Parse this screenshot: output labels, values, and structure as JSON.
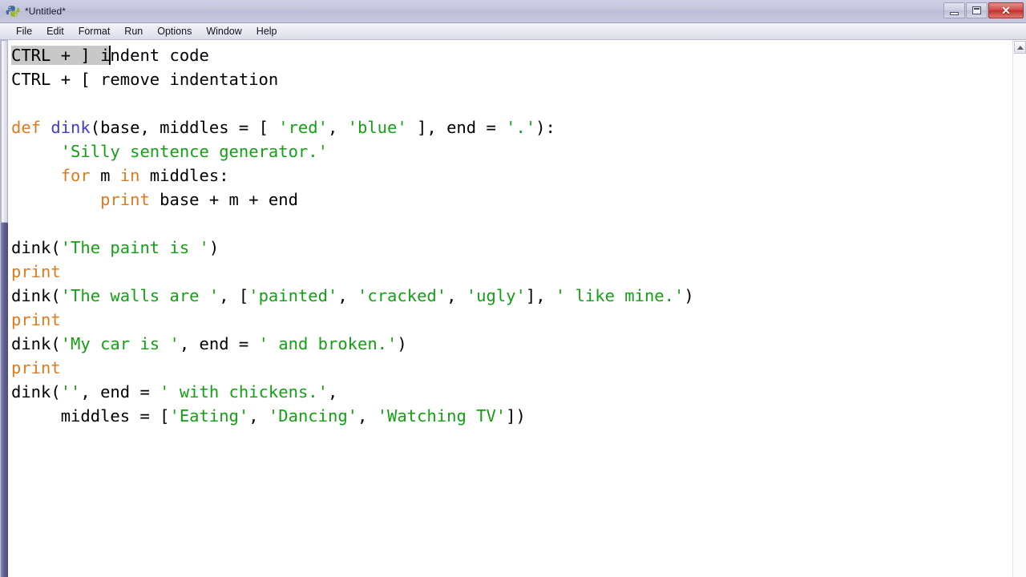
{
  "window": {
    "title": "*Untitled*",
    "icon": "python-idle-icon",
    "buttons": {
      "minimize_label": "–",
      "maximize_label": "□",
      "close_label": "✕"
    }
  },
  "menubar": {
    "items": [
      {
        "label": "File",
        "name": "menu-file"
      },
      {
        "label": "Edit",
        "name": "menu-edit"
      },
      {
        "label": "Format",
        "name": "menu-format"
      },
      {
        "label": "Run",
        "name": "menu-run"
      },
      {
        "label": "Options",
        "name": "menu-options"
      },
      {
        "label": "Window",
        "name": "menu-window"
      },
      {
        "label": "Help",
        "name": "menu-help"
      }
    ]
  },
  "editor": {
    "colors": {
      "keyword": "#e07b1d",
      "definition": "#3f3fbf",
      "string": "#14a014",
      "plain": "#000000",
      "selection": "#c8c8c8",
      "background": "#ffffff"
    },
    "selection_text": "CTRL + ] i",
    "caret_after_selection": true,
    "lines": {
      "l1_selected": "CTRL + ] i",
      "l1_rest": "ndent code",
      "l2": "CTRL + [ remove indentation",
      "l3": "",
      "l4_def": "def",
      "l4_name": " dink",
      "l4_a": "(base, middles = [ ",
      "l4_s1": "'red'",
      "l4_b": ", ",
      "l4_s2": "'blue'",
      "l4_c": " ], end = ",
      "l4_s3": "'.'",
      "l4_d": "):",
      "l5_indent": "     ",
      "l5_str": "'Silly sentence generator.'",
      "l6_indent": "     ",
      "l6_for": "for",
      "l6_m": " m ",
      "l6_in": "in",
      "l6_rest": " middles:",
      "l7_indent": "         ",
      "l7_print": "print",
      "l7_rest": " base + m + end",
      "l8": "",
      "l9_a": "dink(",
      "l9_s": "'The paint is '",
      "l9_b": ")",
      "l10_print": "print",
      "l11_a": "dink(",
      "l11_s1": "'The walls are '",
      "l11_b": ", [",
      "l11_s2": "'painted'",
      "l11_c": ", ",
      "l11_s3": "'cracked'",
      "l11_d": ", ",
      "l11_s4": "'ugly'",
      "l11_e": "], ",
      "l11_s5": "' like mine.'",
      "l11_f": ")",
      "l12_print": "print",
      "l13_a": "dink(",
      "l13_s1": "'My car is '",
      "l13_b": ", end = ",
      "l13_s2": "' and broken.'",
      "l13_c": ")",
      "l14_print": "print",
      "l15_a": "dink(",
      "l15_s1": "''",
      "l15_b": ", end = ",
      "l15_s2": "' with chickens.'",
      "l15_c": ",",
      "l16_indent": "     ",
      "l16_a": "middles = [",
      "l16_s1": "'Eating'",
      "l16_b": ", ",
      "l16_s2": "'Dancing'",
      "l16_c": ", ",
      "l16_s3": "'Watching TV'",
      "l16_d": "])"
    }
  }
}
